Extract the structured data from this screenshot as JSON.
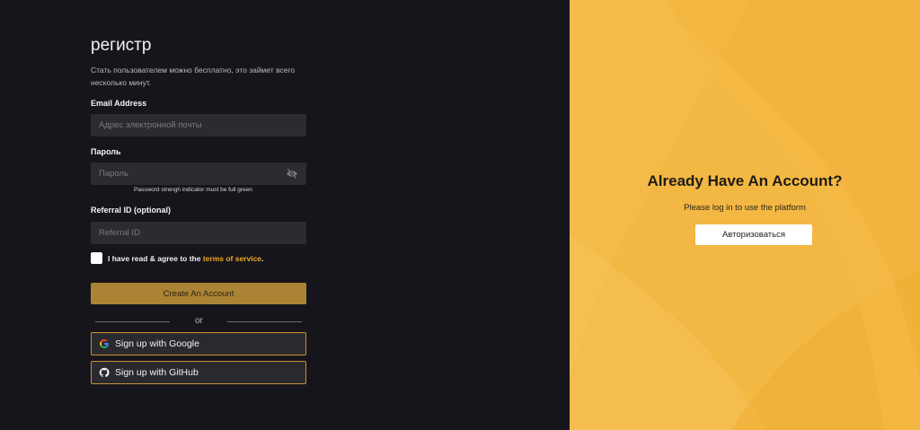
{
  "register": {
    "title": "регистр",
    "subtitle": "Стать пользователем можно бесплатно, это займет всего несколько минут.",
    "email": {
      "label": "Email Address",
      "placeholder": "Адрес электронной почты"
    },
    "password": {
      "label": "Пароль",
      "placeholder": "Пароль",
      "hint": "Password strengh indicator must be full green",
      "toggle_icon": "eye-off-icon"
    },
    "referral": {
      "label": "Referral ID (optional)",
      "placeholder": "Referral ID"
    },
    "agree_text": "I have read & agree to the ",
    "tos_link": "terms of service",
    "agree_end": ".",
    "create_button": "Create An Account",
    "or_text": "or",
    "google_button": "Sign up with Google",
    "github_button": "Sign up with GitHub"
  },
  "login_panel": {
    "title": "Already Have An Account?",
    "subtitle": "Please log in to use the platform",
    "login_button": "Авторизоваться"
  },
  "colors": {
    "left_bg": "#16151b",
    "right_bg": "#f3b743",
    "accent": "#f0a72c",
    "create_button": "#aa8434"
  }
}
